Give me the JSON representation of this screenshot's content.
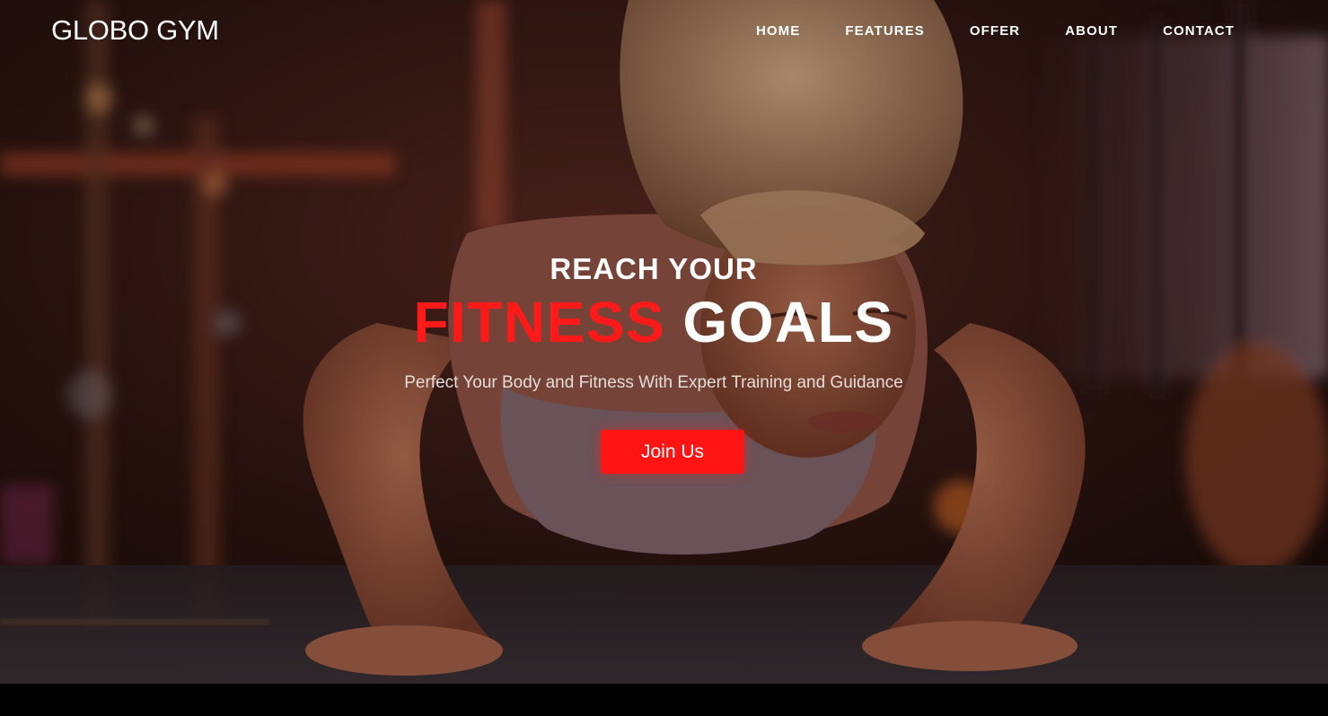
{
  "brand": {
    "name": "GLOBO GYM"
  },
  "nav": {
    "items": [
      {
        "label": "HOME"
      },
      {
        "label": "FEATURES"
      },
      {
        "label": "OFFER"
      },
      {
        "label": "ABOUT"
      },
      {
        "label": "CONTACT"
      }
    ]
  },
  "hero": {
    "title_top": "REACH YOUR",
    "title_accent": "FITNESS",
    "title_rest": "GOALS",
    "subtitle": "Perfect Your Body and Fitness With Expert Training and Guidance",
    "cta_label": "Join Us"
  },
  "colors": {
    "accent": "#ff1414",
    "text": "#ffffff",
    "background": "#000000"
  }
}
